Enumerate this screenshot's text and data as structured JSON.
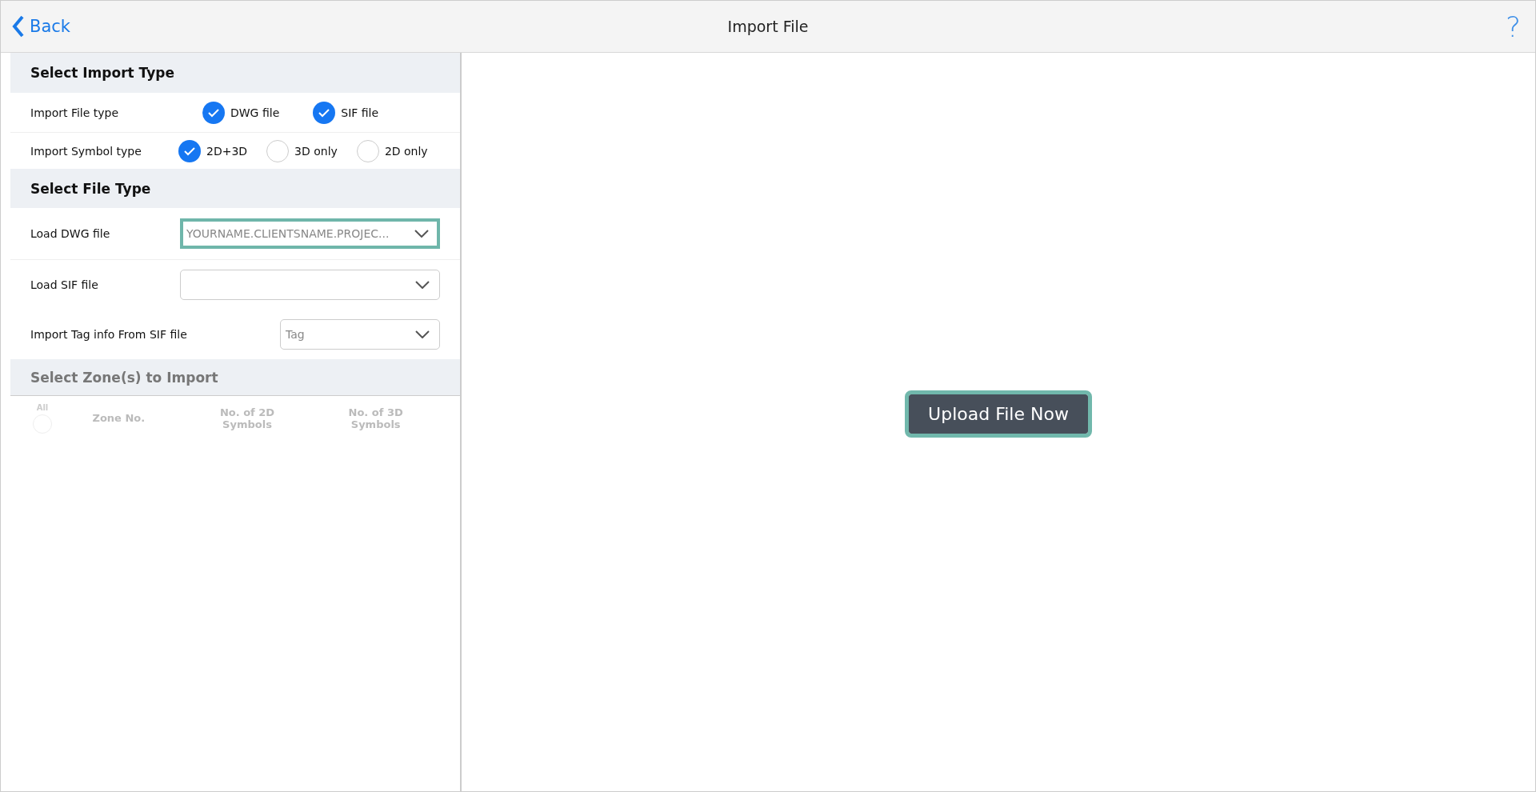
{
  "header": {
    "back": "Back",
    "title": "Import File",
    "help": "?"
  },
  "import_type": {
    "heading": "Select Import Type",
    "rows": [
      {
        "label": "Import File type",
        "options": [
          {
            "label": "DWG file",
            "selected": true
          },
          {
            "label": "SIF file",
            "selected": true
          }
        ]
      },
      {
        "label": "Import Symbol type",
        "options": [
          {
            "label": "2D+3D",
            "selected": true
          },
          {
            "label": "3D only",
            "selected": false
          },
          {
            "label": "2D only",
            "selected": false
          }
        ]
      }
    ]
  },
  "file_type": {
    "heading": "Select File Type",
    "fields": [
      {
        "label": "Load DWG file",
        "value": "YOURNAME.CLIENTSNAME.PROJEC...",
        "focused": true
      },
      {
        "label": "Load SIF file",
        "focused": false
      },
      {
        "label": "Import Tag info From SIF file",
        "value": "Tag",
        "focused": false
      }
    ]
  },
  "zones": {
    "heading": "Select Zone(s) to Import",
    "disabled": true,
    "all_label": "All",
    "all_selected": false,
    "columns": [
      "Zone No.",
      "No. of 2D Symbols",
      "No. of 3D Symbols"
    ]
  },
  "upload_button": {
    "label": "Upload File Now",
    "focused": true
  }
}
